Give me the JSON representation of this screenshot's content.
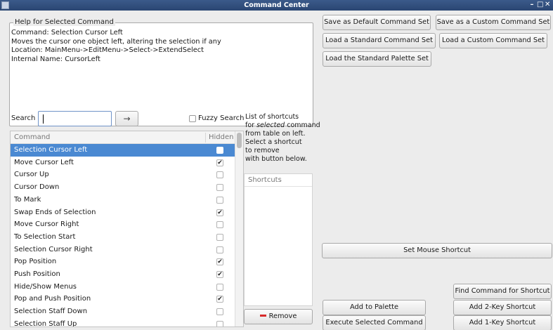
{
  "window": {
    "title": "Command Center",
    "controls": [
      "–",
      "□",
      "✕"
    ]
  },
  "help": {
    "legend": "Help for Selected Command",
    "lines": [
      "Command: Selection Cursor Left",
      "Moves the cursor one object left, altering the selection if any",
      "Location: MainMenu->EditMenu->Select->ExtendSelect",
      "Internal Name: CursorLeft"
    ]
  },
  "search": {
    "label": "Search",
    "value": "",
    "go_glyph": "→",
    "fuzzy_label": "Fuzzy Search",
    "fuzzy_checked": false
  },
  "table": {
    "headers": {
      "command": "Command",
      "hidden": "Hidden"
    },
    "rows": [
      {
        "name": "Selection Cursor Left",
        "hidden": false,
        "selected": true
      },
      {
        "name": "Move Cursor Left",
        "hidden": true
      },
      {
        "name": "Cursor Up",
        "hidden": false
      },
      {
        "name": "Cursor Down",
        "hidden": false
      },
      {
        "name": "To Mark",
        "hidden": false
      },
      {
        "name": "Swap Ends of Selection",
        "hidden": true
      },
      {
        "name": "Move Cursor Right",
        "hidden": false
      },
      {
        "name": "To Selection Start",
        "hidden": false
      },
      {
        "name": "Selection Cursor Right",
        "hidden": false
      },
      {
        "name": "Pop Position",
        "hidden": true
      },
      {
        "name": "Push Position",
        "hidden": true
      },
      {
        "name": "Hide/Show Menus",
        "hidden": false
      },
      {
        "name": "Pop and Push Position",
        "hidden": true
      },
      {
        "name": "Selection Staff Down",
        "hidden": false
      },
      {
        "name": "Selection Staff Up",
        "hidden": false
      }
    ]
  },
  "hint": {
    "line1": "List of shortcuts",
    "line2_pre": "for ",
    "line2_em": "selected",
    "line2_post": " command",
    "line3": "from table on left.",
    "line4": "Select a shortcut",
    "line5": "to remove",
    "line6": "with button below."
  },
  "shortcuts": {
    "header": "Shortcuts",
    "items": []
  },
  "buttons": {
    "save_default": "Save as Default Command Set",
    "save_custom": "Save as a Custom Command Set",
    "load_standard": "Load a Standard Command Set",
    "load_custom": "Load a Custom Command Set",
    "load_palette": "Load the Standard Palette Set",
    "set_mouse": "Set Mouse Shortcut",
    "find_command": "Find Command for Shortcut",
    "add_palette": "Add to Palette",
    "add_2key": "Add 2-Key Shortcut",
    "remove": "Remove",
    "execute": "Execute Selected Command",
    "add_1key": "Add 1-Key Shortcut"
  },
  "colors": {
    "selection": "#4a89d2",
    "titlebar": "#2a4672",
    "remove_icon": "#d72a2a"
  }
}
